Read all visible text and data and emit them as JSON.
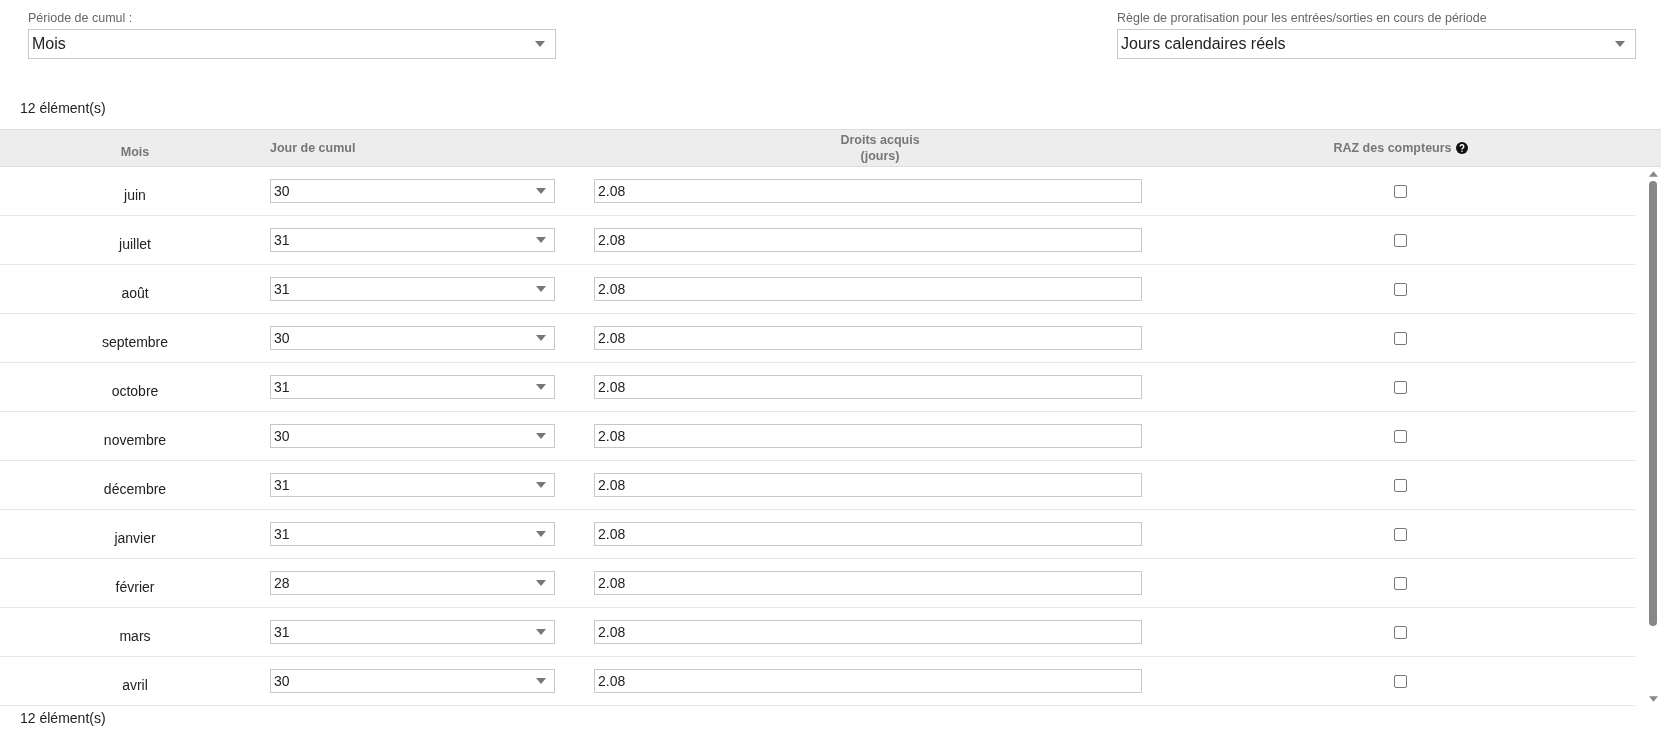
{
  "filters": [
    {
      "label": "Période de cumul :",
      "value": "Mois"
    },
    {
      "label": "Règle de proratisation pour les entrées/sorties en cours de période",
      "value": "Jours calendaires réels"
    }
  ],
  "count_top": "12 élément(s)",
  "table": {
    "columns": [
      {
        "label": "Mois",
        "kind": "text"
      },
      {
        "label": "Jour de cumul",
        "kind": "select"
      },
      {
        "label": "Droits acquis",
        "sublabel": "(jours)",
        "kind": "input"
      },
      {
        "label": "RAZ des compteurs",
        "kind": "check",
        "help": true
      }
    ],
    "rows": [
      {
        "month": "juin",
        "day": "30",
        "rights": "2.08",
        "reset": false
      },
      {
        "month": "juillet",
        "day": "31",
        "rights": "2.08",
        "reset": false
      },
      {
        "month": "août",
        "day": "31",
        "rights": "2.08",
        "reset": false
      },
      {
        "month": "septembre",
        "day": "30",
        "rights": "2.08",
        "reset": false
      },
      {
        "month": "octobre",
        "day": "31",
        "rights": "2.08",
        "reset": false
      },
      {
        "month": "novembre",
        "day": "30",
        "rights": "2.08",
        "reset": false
      },
      {
        "month": "décembre",
        "day": "31",
        "rights": "2.08",
        "reset": false
      },
      {
        "month": "janvier",
        "day": "31",
        "rights": "2.08",
        "reset": false
      },
      {
        "month": "février",
        "day": "28",
        "rights": "2.08",
        "reset": false
      },
      {
        "month": "mars",
        "day": "31",
        "rights": "2.08",
        "reset": false
      },
      {
        "month": "avril",
        "day": "30",
        "rights": "2.08",
        "reset": false
      }
    ]
  },
  "count_bottom": "12 élément(s)"
}
